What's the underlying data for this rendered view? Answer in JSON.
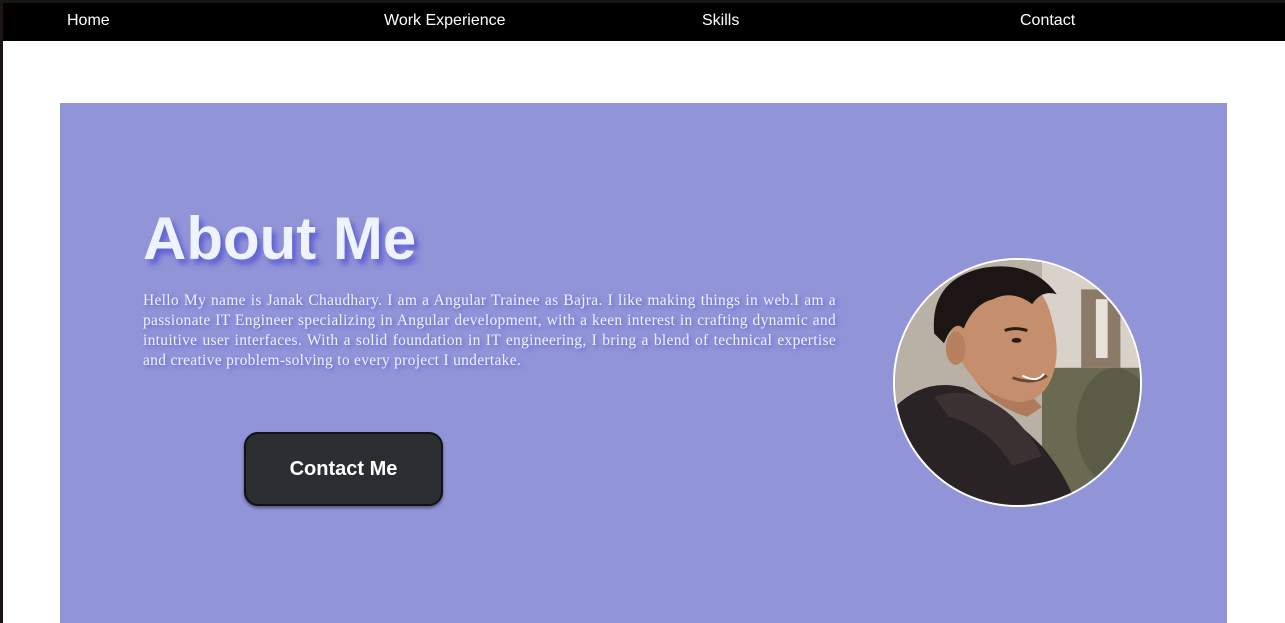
{
  "nav": {
    "home": "Home",
    "work": "Work Experience",
    "skills": "Skills",
    "contact": "Contact"
  },
  "about": {
    "title": "About Me",
    "text": "Hello My name is Janak Chaudhary. I am a Angular Trainee as Bajra. I like making things in web.I am a passionate IT Engineer specializing in Angular development, with a keen interest in crafting dynamic and intuitive user interfaces. With a solid foundation in IT engineering, I bring a blend of technical expertise and creative problem-solving to every project I undertake.",
    "button_label": "Contact Me"
  },
  "colors": {
    "navbar": "#000000",
    "section_bg": "#9294d8",
    "button_bg": "#2b2e31",
    "heading_text": "#eef3ff"
  }
}
